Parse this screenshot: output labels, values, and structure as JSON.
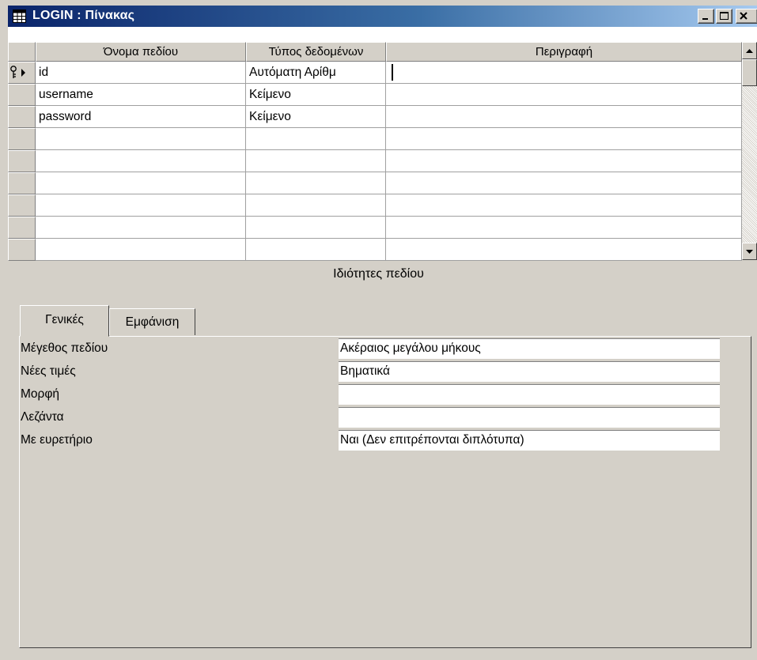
{
  "window": {
    "title": "LOGIN : Πίνακας",
    "icon": "table-icon",
    "buttons": [
      "minimize-icon",
      "maximize-icon",
      "close-icon"
    ]
  },
  "grid": {
    "columns": [
      "Όνομα πεδίου",
      "Τύπος δεδομένων",
      "Περιγραφή"
    ],
    "rows": [
      {
        "name": "id",
        "type": "Αυτόματη Αρίθμ",
        "description": "",
        "primary_key": true,
        "current": true
      },
      {
        "name": "username",
        "type": "Κείμενο",
        "description": ""
      },
      {
        "name": "password",
        "type": "Κείμενο",
        "description": ""
      },
      {
        "name": "",
        "type": "",
        "description": ""
      },
      {
        "name": "",
        "type": "",
        "description": ""
      },
      {
        "name": "",
        "type": "",
        "description": ""
      },
      {
        "name": "",
        "type": "",
        "description": ""
      },
      {
        "name": "",
        "type": "",
        "description": ""
      },
      {
        "name": "",
        "type": "",
        "description": ""
      }
    ]
  },
  "properties": {
    "section_label": "Ιδιότητες πεδίου",
    "tabs": [
      "Γενικές",
      "Εμφάνιση"
    ],
    "active_tab": "Γενικές",
    "rows": [
      {
        "label": "Μέγεθος πεδίου",
        "value": "Ακέραιος μεγάλου μήκους"
      },
      {
        "label": "Νέες τιμές",
        "value": "Βηματικά"
      },
      {
        "label": "Μορφή",
        "value": ""
      },
      {
        "label": "Λεζάντα",
        "value": ""
      },
      {
        "label": "Με ευρετήριο",
        "value": "Ναι (Δεν επιτρέπονται διπλότυπα)"
      }
    ]
  },
  "colors": {
    "titlebar_start": "#0a246a",
    "titlebar_end": "#a6caf0",
    "face": "#d4d0c8"
  }
}
